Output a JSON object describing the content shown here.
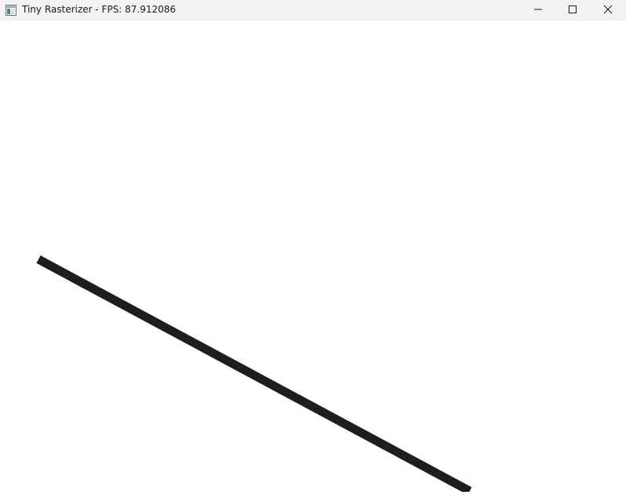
{
  "window": {
    "title": "Tiny Rasterizer - FPS: 87.912086",
    "icon": "app-window-icon",
    "controls": {
      "minimize_icon": "minimize-icon",
      "maximize_icon": "maximize-icon",
      "close_icon": "close-icon"
    }
  },
  "canvas": {
    "background": "#ffffff",
    "line_color": "#1e1e20"
  }
}
